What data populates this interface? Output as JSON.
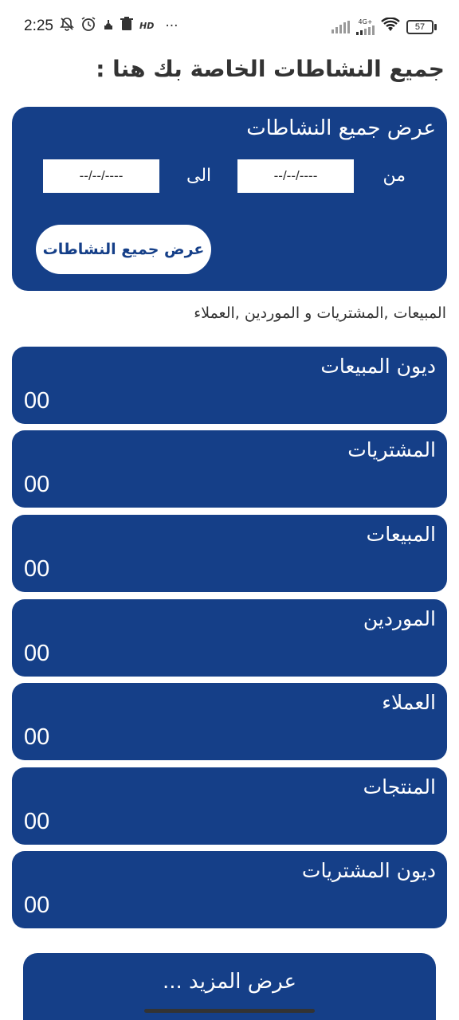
{
  "status_bar": {
    "time": "2:25",
    "icons": [
      "bell-muted-icon",
      "alarm-icon",
      "mosque-icon",
      "trash-icon",
      "hd-icon",
      "more-dots-icon"
    ],
    "hd_label": "HD",
    "more_label": "···",
    "network_label": "4G+",
    "battery": "57"
  },
  "header": {
    "title": "جميع النشاطات الخاصة بك هنا :"
  },
  "filter": {
    "title": "عرض جميع النشاطات",
    "from_label": "من",
    "to_label": "الى",
    "from_date_value": "--/--/----",
    "to_date_value": "--/--/----",
    "show_button_label": "عرض جميع النشاطات"
  },
  "section": {
    "subtitle": "المبيعات ,المشتريات و الموردين ,العملاء"
  },
  "stats": [
    {
      "title": "ديون المبيعات",
      "value": "00"
    },
    {
      "title": "المشتريات",
      "value": "00"
    },
    {
      "title": "المبيعات",
      "value": "00"
    },
    {
      "title": "الموردين",
      "value": "00"
    },
    {
      "title": "العملاء",
      "value": "00"
    },
    {
      "title": "المنتجات",
      "value": "00"
    },
    {
      "title": "ديون المشتريات",
      "value": "00"
    }
  ],
  "footer": {
    "more_button_label": "عرض المزيد ..."
  },
  "colors": {
    "primary": "#153f88",
    "background": "#ffffff",
    "text": "#333333"
  }
}
